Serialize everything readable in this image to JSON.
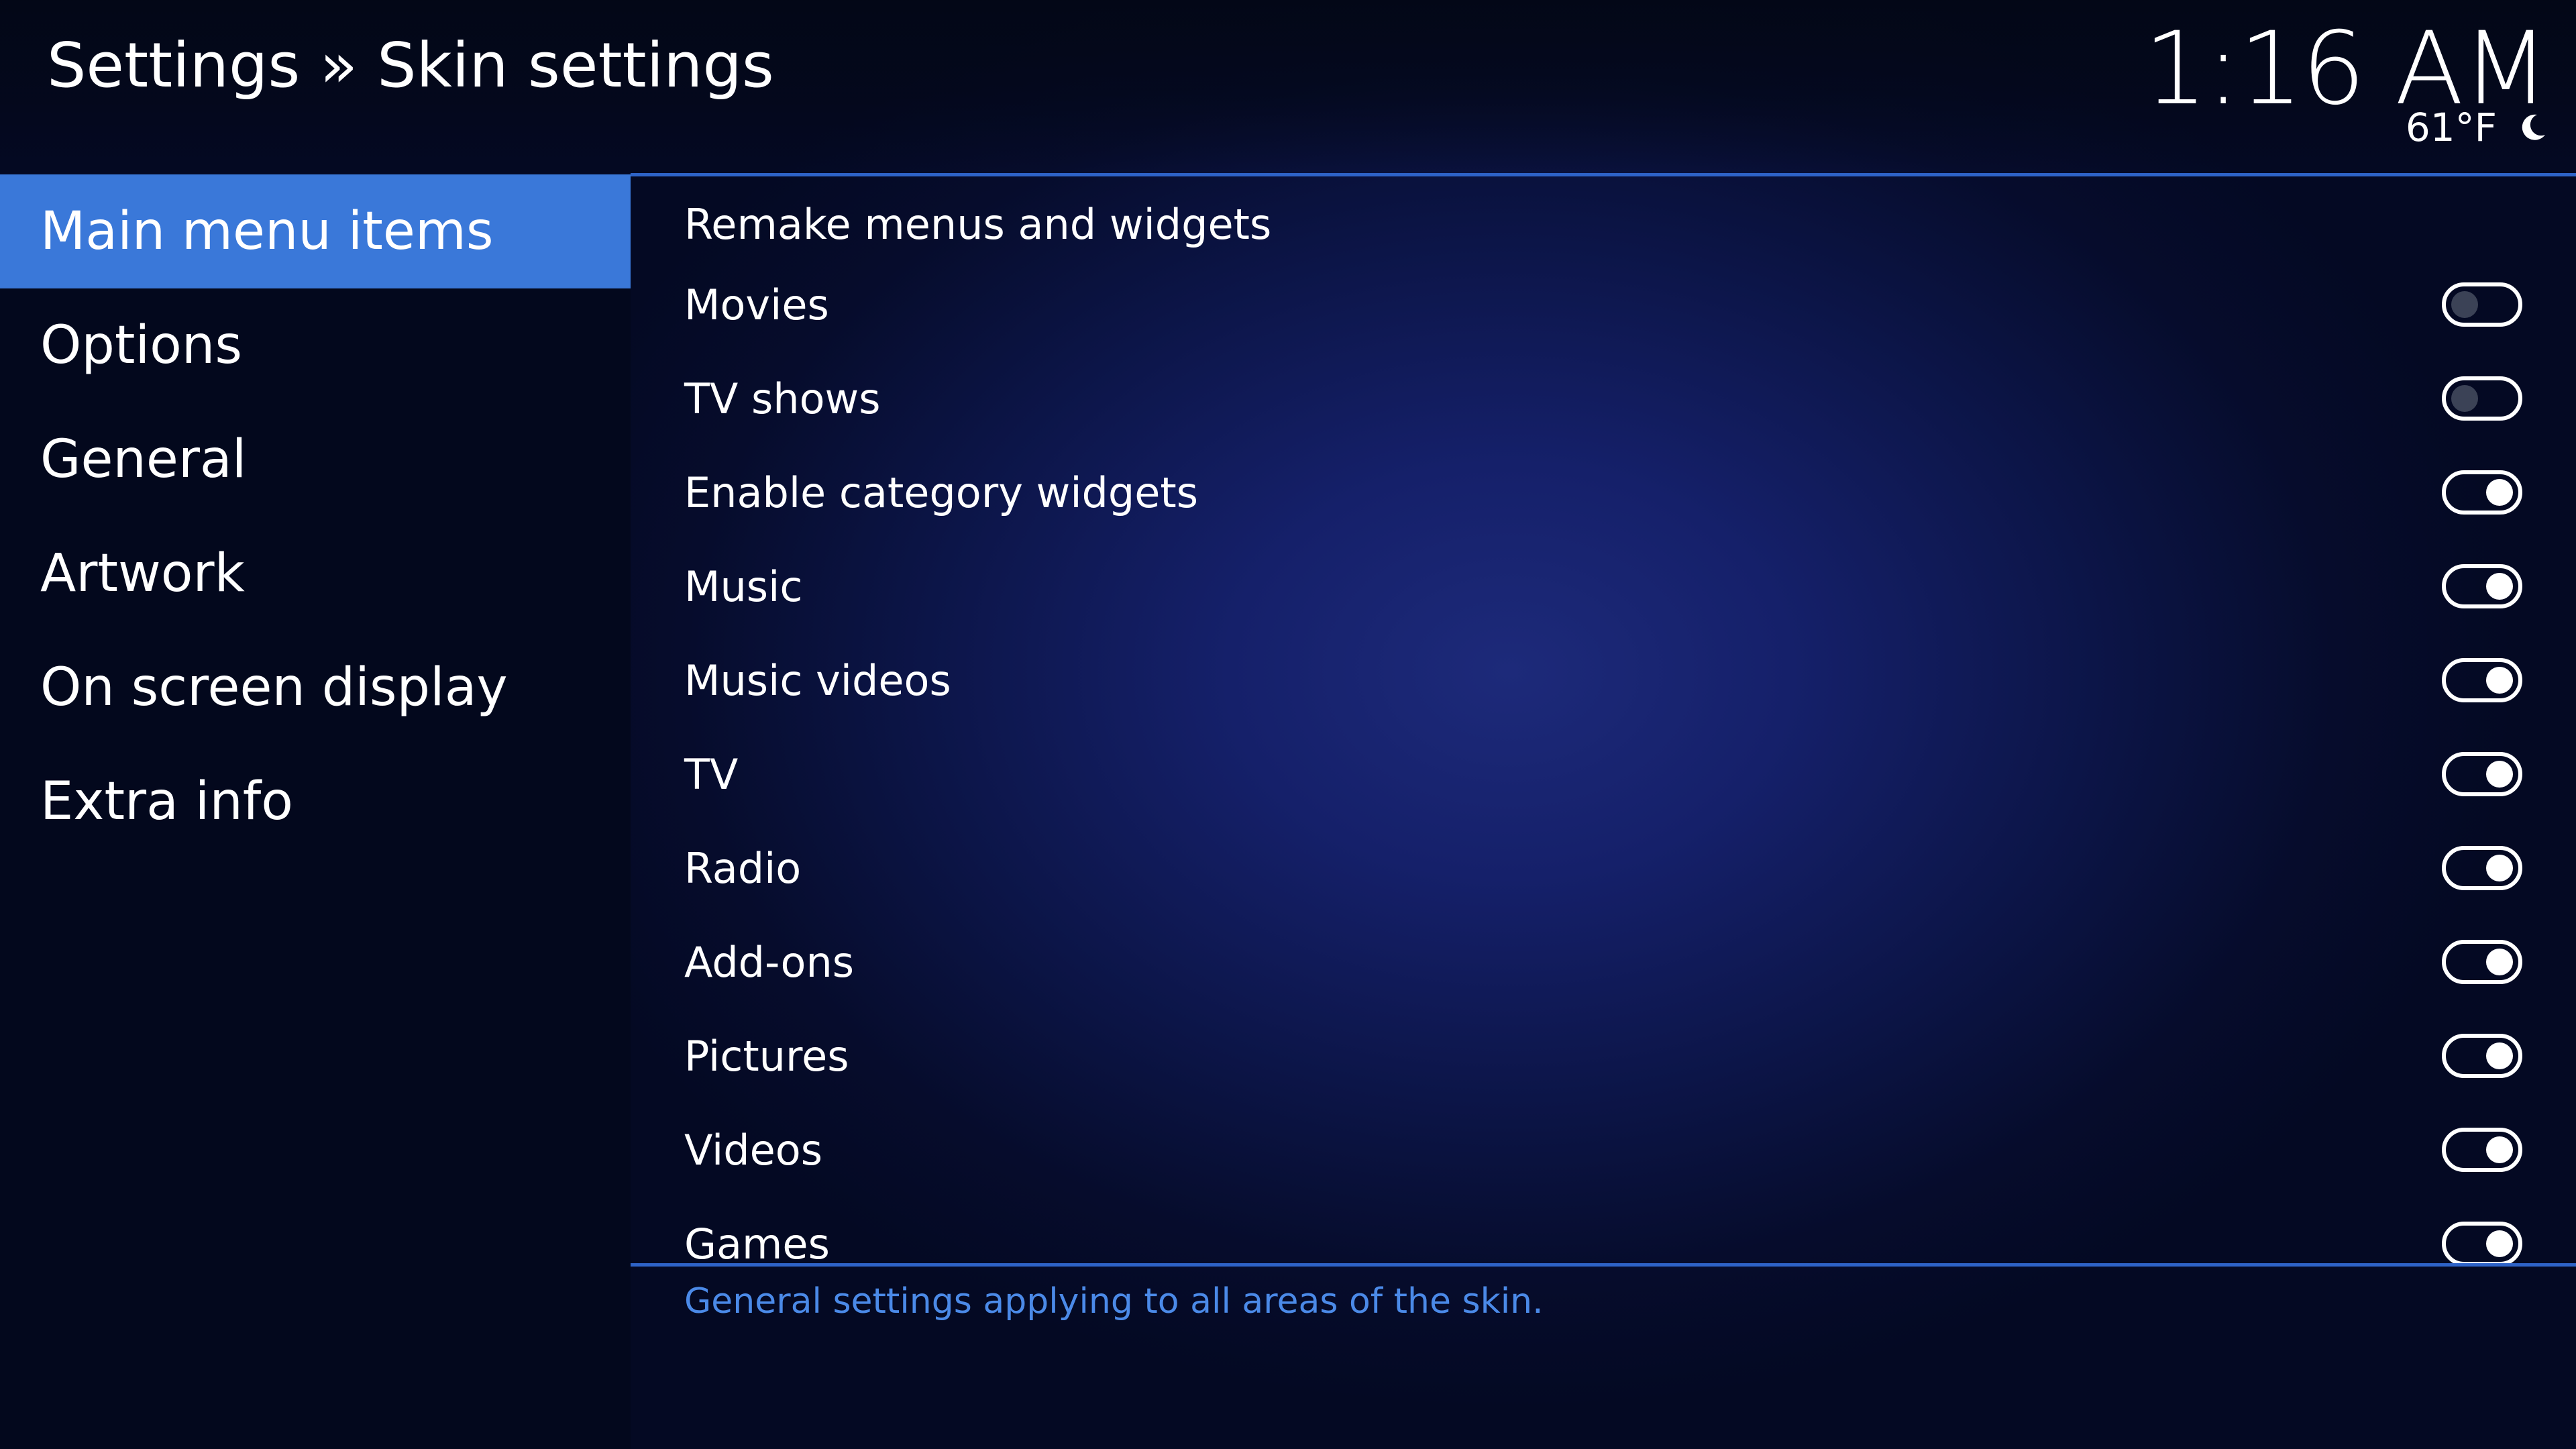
{
  "header": {
    "title": "Settings » Skin settings",
    "time": "1:16 AM",
    "temperature": "61°F",
    "weather_icon": "moon-icon"
  },
  "sidebar": {
    "items": [
      {
        "label": "Main menu items",
        "selected": true
      },
      {
        "label": "Options",
        "selected": false
      },
      {
        "label": "General",
        "selected": false
      },
      {
        "label": "Artwork",
        "selected": false
      },
      {
        "label": "On screen display",
        "selected": false
      },
      {
        "label": "Extra info",
        "selected": false
      }
    ]
  },
  "settings": {
    "rows": [
      {
        "label": "Remake menus and widgets",
        "toggle": null
      },
      {
        "label": "Movies",
        "toggle": false
      },
      {
        "label": "TV shows",
        "toggle": false
      },
      {
        "label": "Enable category widgets",
        "toggle": true
      },
      {
        "label": "Music",
        "toggle": true
      },
      {
        "label": "Music videos",
        "toggle": true
      },
      {
        "label": "TV",
        "toggle": true
      },
      {
        "label": "Radio",
        "toggle": true
      },
      {
        "label": "Add-ons",
        "toggle": true
      },
      {
        "label": "Pictures",
        "toggle": true
      },
      {
        "label": "Videos",
        "toggle": true
      },
      {
        "label": "Games",
        "toggle": true
      }
    ]
  },
  "description": "General settings applying to all areas of the skin.",
  "colors": {
    "accent": "#3a78d9",
    "description_text": "#4b8ae8",
    "sidebar_bg": "#03081d"
  }
}
